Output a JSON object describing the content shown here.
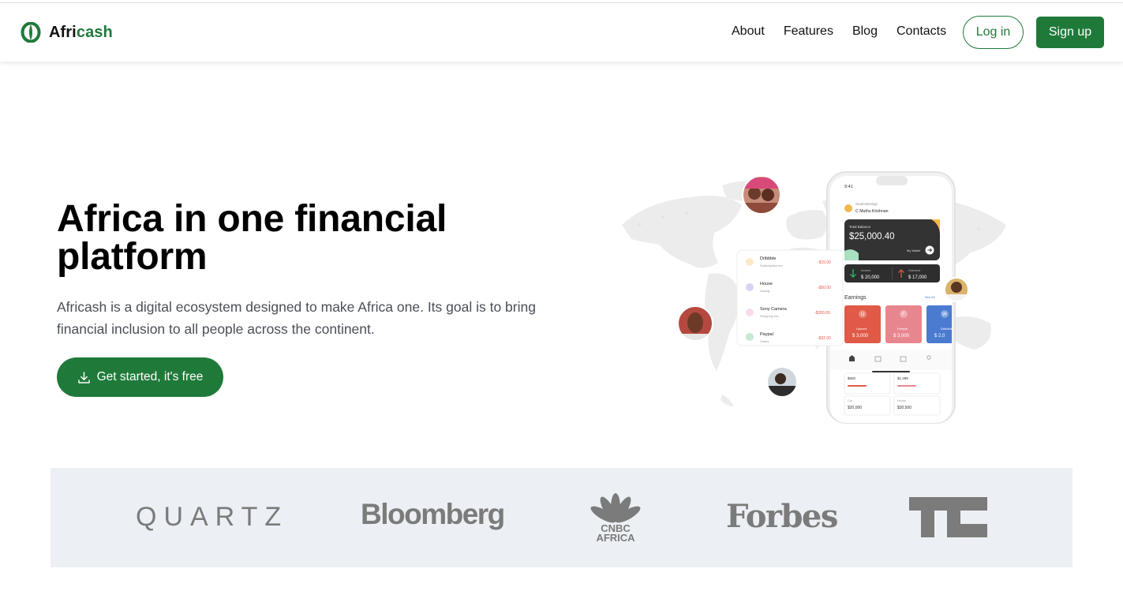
{
  "brand": {
    "name_part1": "Afri",
    "name_part2": "cash",
    "accent_color": "#1f7a3a",
    "logo_icon": "leaf-ring-icon"
  },
  "nav": {
    "links": [
      "About",
      "Features",
      "Blog",
      "Contacts"
    ],
    "login_label": "Log in",
    "signup_label": "Sign up"
  },
  "hero": {
    "title": "Africa in one financial platform",
    "description": "Africash is a digital ecosystem designed to make Africa one. Its goal is to bring financial inclusion to all people across the continent.",
    "cta_label": "Get started, it's free",
    "cta_icon": "download-icon"
  },
  "phone": {
    "time": "9:41",
    "greeting": "Good Morning!",
    "user": "C Muthu Krishnan",
    "balance_label": "Total Balance",
    "balance": "$25,000.40",
    "wallet_label": "My Wallet",
    "income_label": "Income",
    "income": "$ 20,000",
    "outcome_label": "Outcome",
    "outcome": "$ 17,000",
    "earnings_title": "Earnings",
    "see_all": "See All",
    "earning_cards": [
      {
        "letter": "U",
        "name": "Upwork",
        "amount": "$ 3,000",
        "color": "#e05a47"
      },
      {
        "letter": "F",
        "name": "Freepik",
        "amount": "$ 3,000",
        "color": "#e8868f"
      },
      {
        "letter": "W",
        "name": "Dribbble",
        "amount": "$ 2,0",
        "color": "#4a7bd0"
      }
    ],
    "bottom_cells": [
      {
        "label": "",
        "amount": "$500"
      },
      {
        "label": "",
        "amount": "$1,499"
      },
      {
        "label": "Car",
        "amount": "$20,000"
      },
      {
        "label": "House",
        "amount": "$30,500"
      }
    ]
  },
  "transactions": [
    {
      "name": "Dribbble",
      "sub": "Subscription fee",
      "amount": "-$15.00",
      "color": "#f2b84b"
    },
    {
      "name": "House",
      "sub": "Saving",
      "amount": "-$50.00",
      "color": "#7b6fd6"
    },
    {
      "name": "Sony Camera",
      "sub": "Shopping fee",
      "amount": "-$200.00",
      "color": "#e58ac4"
    },
    {
      "name": "Paypal",
      "sub": "Salary",
      "amount": "-$32.00",
      "color": "#4caf6a"
    }
  ],
  "press": {
    "logos": [
      "QUARTZ",
      "Bloomberg",
      "CNBC AFRICA",
      "Forbes",
      "TC"
    ]
  }
}
